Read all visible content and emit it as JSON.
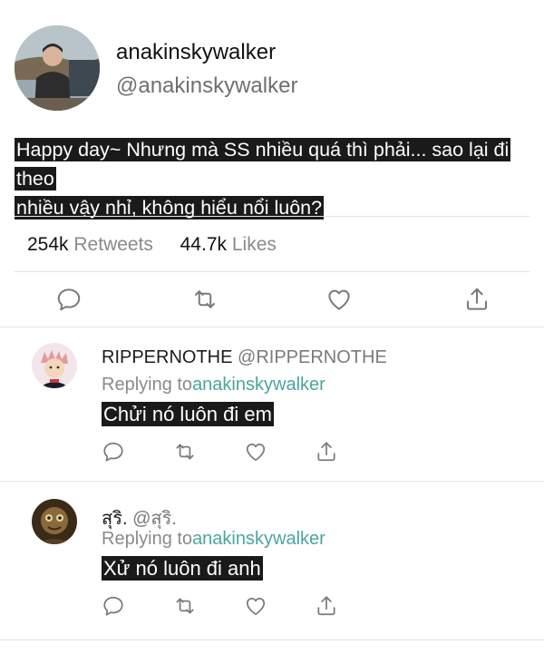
{
  "main_tweet": {
    "name": "anakinskywalker",
    "handle": "@anakinskywalker",
    "text_line1": "Happy day~ Nhưng mà SS nhiều quá thì phải... sao lại đi theo",
    "text_line2": "nhiều vậy nhỉ, không hiểu nổi luôn?",
    "retweets_count": "254k",
    "retweets_label": "Retweets",
    "likes_count": "44.7k",
    "likes_label": "Likes"
  },
  "replies": [
    {
      "name": "RIPPERNOTHE",
      "handle": "@RIPPERNOTHE",
      "replying_prefix": "Replying to",
      "replying_to": "anakinskywalker",
      "text": "Chửi nó luôn đi em"
    },
    {
      "name": "สุริ.",
      "handle": "@สุริ.",
      "replying_prefix": "Replying to",
      "replying_to": "anakinskywalker",
      "text": "Xử nó luôn đi anh"
    }
  ],
  "icons": [
    "comment-icon",
    "retweet-icon",
    "like-icon",
    "share-icon"
  ],
  "colors": {
    "highlight_bg": "#1a1a1a",
    "link": "#4aa5a0",
    "muted": "#8a8a8a",
    "divider": "#e3e3e3"
  }
}
